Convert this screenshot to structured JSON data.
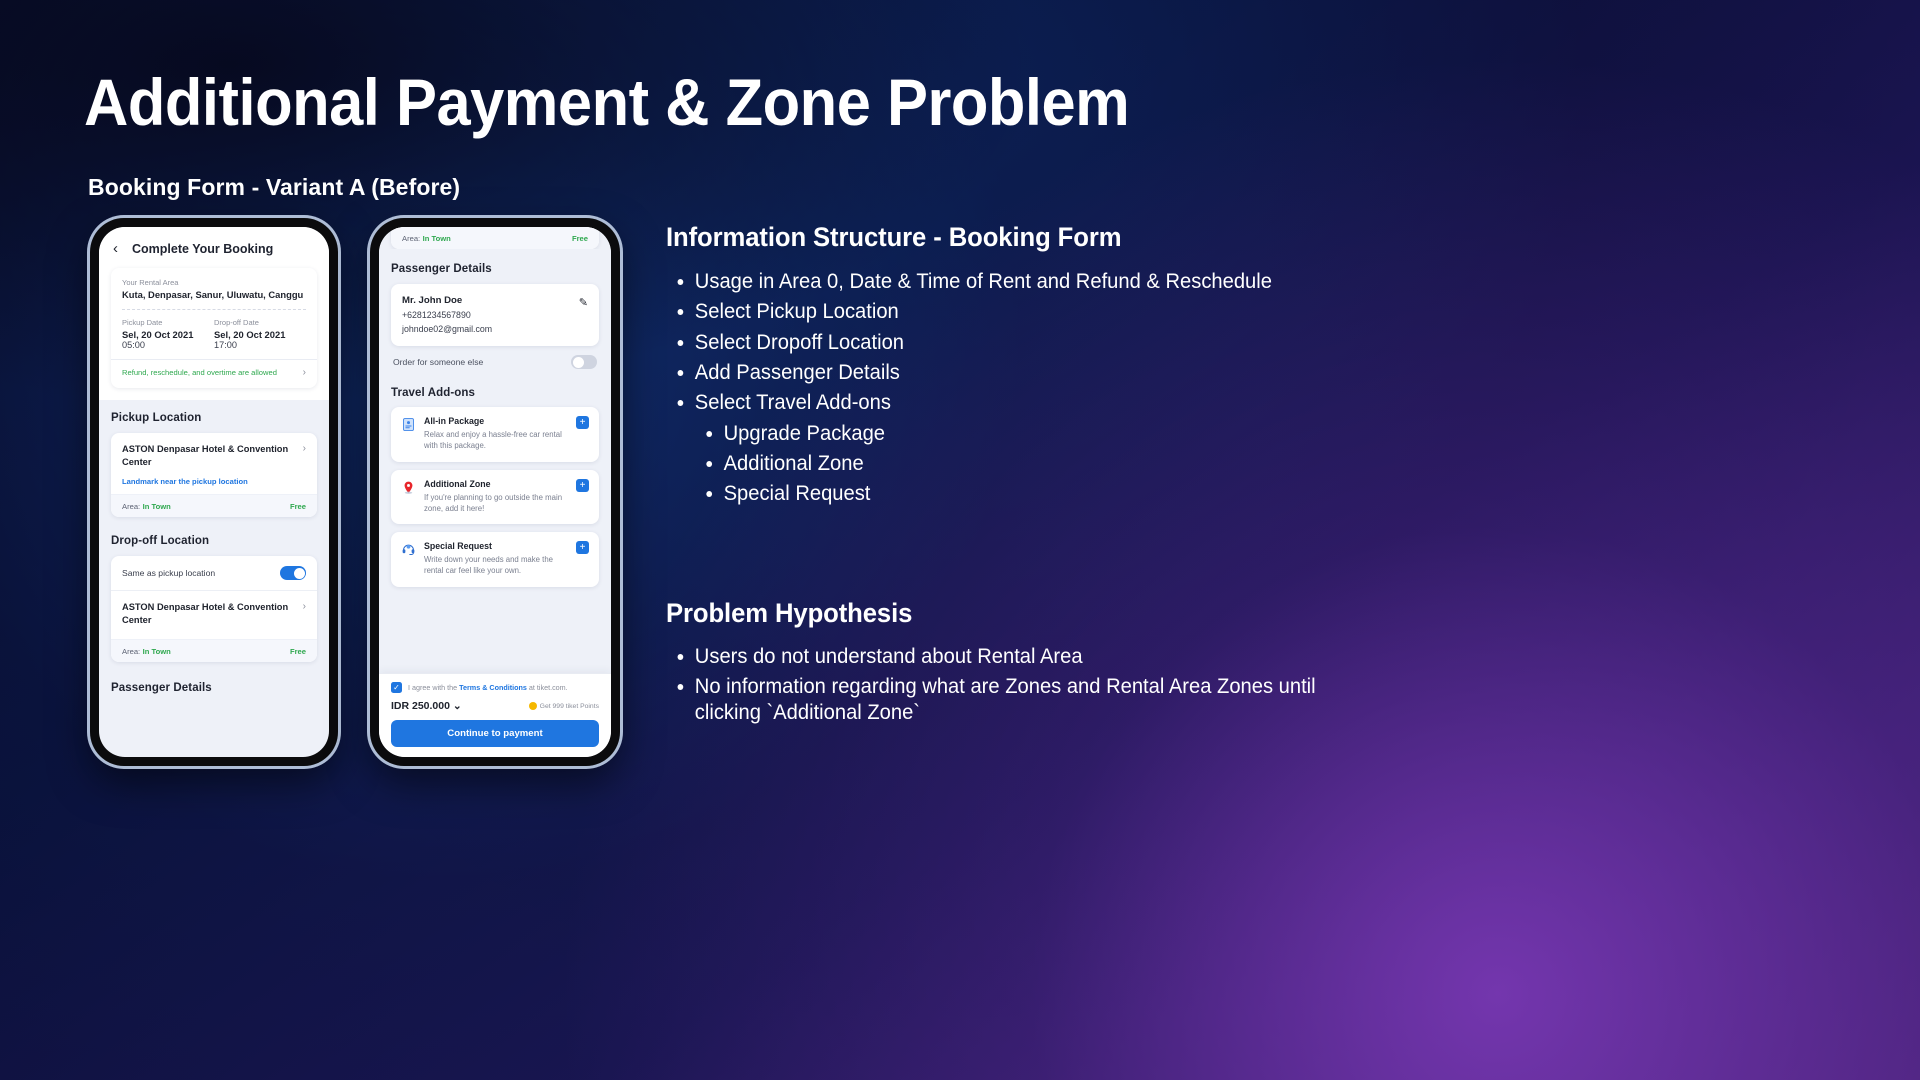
{
  "slide": {
    "title": "Additional Payment & Zone Problem",
    "subtitle": "Booking Form - Variant A (Before)"
  },
  "colors": {
    "accent_blue": "#1f76e0",
    "green": "#2fa84f",
    "app_bg": "#eef1f8",
    "bg_navy": "#0a1038",
    "bg_purple": "#4a2478"
  },
  "phone_a": {
    "appbar": {
      "back_icon": "chevron-left-icon",
      "title": "Complete Your Booking"
    },
    "rental": {
      "area_label": "Your Rental Area",
      "area_value": "Kuta, Denpasar, Sanur, Uluwatu, Canggu",
      "pickup_date_label": "Pickup Date",
      "pickup_date_value": "Sel, 20 Oct 2021",
      "pickup_time": "05:00",
      "dropoff_date_label": "Drop-off Date",
      "dropoff_date_value": "Sel, 20 Oct 2021",
      "dropoff_time": "17:00",
      "refund_text": "Refund, reschedule, and overtime are allowed",
      "refund_chevron": "chevron-right-icon"
    },
    "pickup": {
      "heading": "Pickup Location",
      "name": "ASTON Denpasar Hotel & Convention Center",
      "chevron": "chevron-right-icon",
      "landmark": "Landmark near the pickup location",
      "area_label": "Area:",
      "area_value": "In Town",
      "price": "Free"
    },
    "dropoff": {
      "heading": "Drop-off Location",
      "same_label": "Same as pickup location",
      "toggle_state": "on",
      "name": "ASTON Denpasar Hotel & Convention Center",
      "chevron": "chevron-right-icon",
      "area_label": "Area:",
      "area_value": "In Town",
      "price": "Free"
    },
    "passenger_heading": "Passenger Details"
  },
  "phone_b": {
    "top_area": {
      "area_label": "Area:",
      "area_value": "In Town",
      "price": "Free"
    },
    "passenger": {
      "heading": "Passenger Details",
      "name": "Mr. John Doe",
      "phone": "+6281234567890",
      "email": "johndoe02@gmail.com",
      "edit_icon": "pencil-icon",
      "order_for_label": "Order for someone else",
      "order_for_toggle": "off"
    },
    "addons": {
      "heading": "Travel Add-ons",
      "items": [
        {
          "icon": "id-card-icon",
          "title": "All-in Package",
          "desc": "Relax and enjoy a hassle-free car rental with this package.",
          "action": "+"
        },
        {
          "icon": "map-pin-icon",
          "title": "Additional Zone",
          "desc": "If you're planning to go outside the main zone, add it here!",
          "action": "+"
        },
        {
          "icon": "headset-icon",
          "title": "Special Request",
          "desc": "Write down your needs and make the rental car feel like your own.",
          "action": "+"
        }
      ]
    },
    "footer": {
      "checkbox_state": "checked",
      "terms_prefix": "I agree with the ",
      "terms_link": "Terms & Conditions",
      "terms_suffix": " at tiket.com.",
      "price": "IDR 250.000",
      "price_chevron": "chevron-down-icon",
      "points_icon": "coin-icon",
      "points_text": "Get 999 tiket Points",
      "cta_label": "Continue to payment"
    }
  },
  "panel": {
    "info_heading": "Information Structure - Booking Form",
    "info_items": [
      {
        "text": "Usage in Area 0, Date & Time of Rent and Refund & Reschedule",
        "level": 1
      },
      {
        "text": "Select Pickup Location",
        "level": 1
      },
      {
        "text": "Select Dropoff Location",
        "level": 1
      },
      {
        "text": "Add Passenger Details",
        "level": 1
      },
      {
        "text": "Select Travel Add-ons",
        "level": 1
      },
      {
        "text": "Upgrade Package",
        "level": 2
      },
      {
        "text": "Additional Zone",
        "level": 2
      },
      {
        "text": "Special Request",
        "level": 2
      }
    ],
    "problem_heading": "Problem Hypothesis",
    "problem_items": [
      {
        "text": "Users do not understand about Rental Area"
      },
      {
        "text": "No information regarding what are Zones and Rental Area Zones until clicking `Additional Zone`"
      }
    ]
  }
}
